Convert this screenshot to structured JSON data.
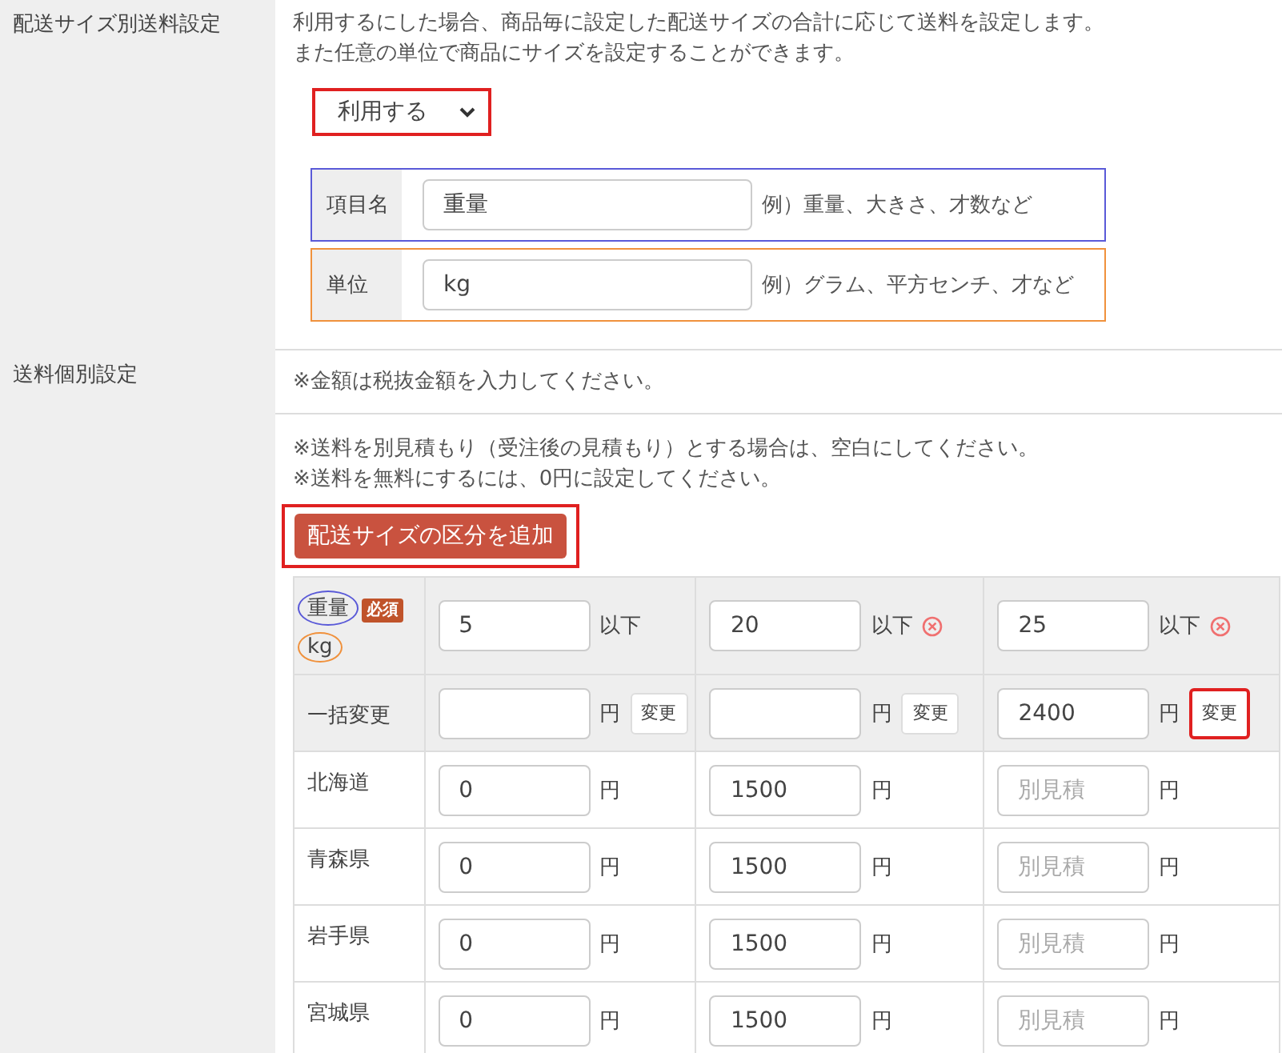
{
  "size_shipping": {
    "label": "配送サイズ別送料設定",
    "description": [
      "利用するにした場合、商品毎に設定した配送サイズの合計に応じて送料を設定します。",
      "また任意の単位で商品にサイズを設定することができます。"
    ],
    "select": {
      "value": "利用する",
      "highlighted": true
    },
    "fields": [
      {
        "label": "項目名",
        "value": "重量",
        "hint": "例）重量、大きさ、才数など",
        "color": "#5a5ad8"
      },
      {
        "label": "単位",
        "value": "kg",
        "hint": "例）グラム、平方センチ、才など",
        "color": "#f0913c"
      }
    ]
  },
  "individual": {
    "label": "送料個別設定",
    "note": "※金額は税抜金額を入力してください。",
    "notes": [
      "※送料を別見積もり（受注後の見積もり）とする場合は、空白にしてください。",
      "※送料を無料にするには、0円に設定してください。"
    ],
    "add_button": {
      "label": "配送サイズの区分を追加",
      "highlighted": true
    },
    "table": {
      "item_name": "重量",
      "required_badge": "必須",
      "unit": "kg",
      "columns": [
        {
          "value": "5",
          "suffix": "以下",
          "removable": false
        },
        {
          "value": "20",
          "suffix": "以下",
          "removable": true
        },
        {
          "value": "25",
          "suffix": "以下",
          "removable": true
        }
      ],
      "bulk": {
        "label": "一括変更",
        "cells": [
          {
            "currency": "円",
            "button": "変更",
            "highlighted": false
          },
          {
            "currency": "円",
            "button": "変更",
            "highlighted": false
          },
          {
            "value": "2400",
            "currency": "円",
            "button": "変更",
            "highlighted": true
          }
        ]
      },
      "rows": [
        {
          "name": "北海道",
          "cells": [
            {
              "value": "0",
              "currency": "円"
            },
            {
              "value": "1500",
              "currency": "円"
            },
            {
              "placeholder": "別見積",
              "currency": "円"
            }
          ]
        },
        {
          "name": "青森県",
          "cells": [
            {
              "value": "0",
              "currency": "円"
            },
            {
              "value": "1500",
              "currency": "円"
            },
            {
              "placeholder": "別見積",
              "currency": "円"
            }
          ]
        },
        {
          "name": "岩手県",
          "cells": [
            {
              "value": "0",
              "currency": "円"
            },
            {
              "value": "1500",
              "currency": "円"
            },
            {
              "placeholder": "別見積",
              "currency": "円"
            }
          ]
        },
        {
          "name": "宮城県",
          "cells": [
            {
              "value": "0",
              "currency": "円"
            },
            {
              "value": "1500",
              "currency": "円"
            },
            {
              "placeholder": "別見積",
              "currency": "円"
            }
          ]
        }
      ]
    }
  }
}
